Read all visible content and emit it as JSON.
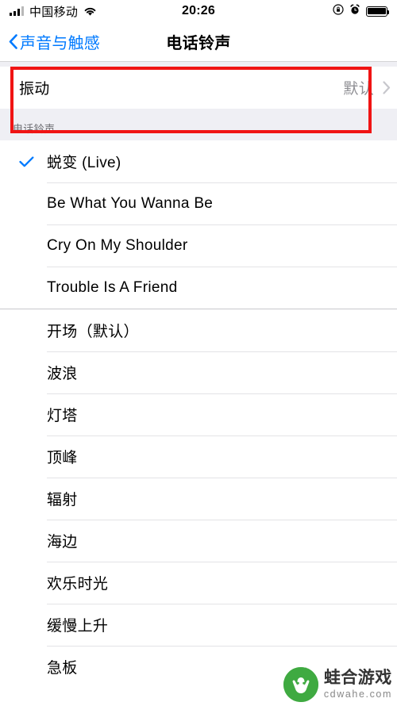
{
  "status_bar": {
    "carrier": "中国移动",
    "time": "20:26",
    "signal_icon": "cellular-signal-icon",
    "wifi_icon": "wifi-icon",
    "rotation_lock_icon": "rotation-lock-icon",
    "alarm_icon": "alarm-clock-icon",
    "battery_icon": "battery-full-icon"
  },
  "nav": {
    "back_label": "声音与触感",
    "back_icon": "chevron-left-icon",
    "title": "电话铃声"
  },
  "vibration": {
    "label": "振动",
    "value": "默认",
    "chevron_icon": "chevron-right-icon"
  },
  "section": {
    "header": "电话铃声"
  },
  "custom_ringtones": [
    {
      "label": "蜕变 (Live)",
      "selected": true
    },
    {
      "label": "Be What You Wanna Be",
      "selected": false
    },
    {
      "label": "Cry On My Shoulder",
      "selected": false
    },
    {
      "label": "Trouble Is A Friend",
      "selected": false
    }
  ],
  "stock_ringtones": [
    {
      "label": "开场（默认）",
      "selected": false
    },
    {
      "label": "波浪",
      "selected": false
    },
    {
      "label": "灯塔",
      "selected": false
    },
    {
      "label": "顶峰",
      "selected": false
    },
    {
      "label": "辐射",
      "selected": false
    },
    {
      "label": "海边",
      "selected": false
    },
    {
      "label": "欢乐时光",
      "selected": false
    },
    {
      "label": "缓慢上升",
      "selected": false
    },
    {
      "label": "急板",
      "selected": false
    }
  ],
  "watermark": {
    "name": "蛙合游戏",
    "url": "cdwahe.com",
    "logo_icon": "frog-logo-icon"
  },
  "colors": {
    "accent_blue": "#007aff",
    "annotation_red": "#f01414",
    "group_bg": "#efeff4",
    "brand_green": "#3faa41"
  }
}
